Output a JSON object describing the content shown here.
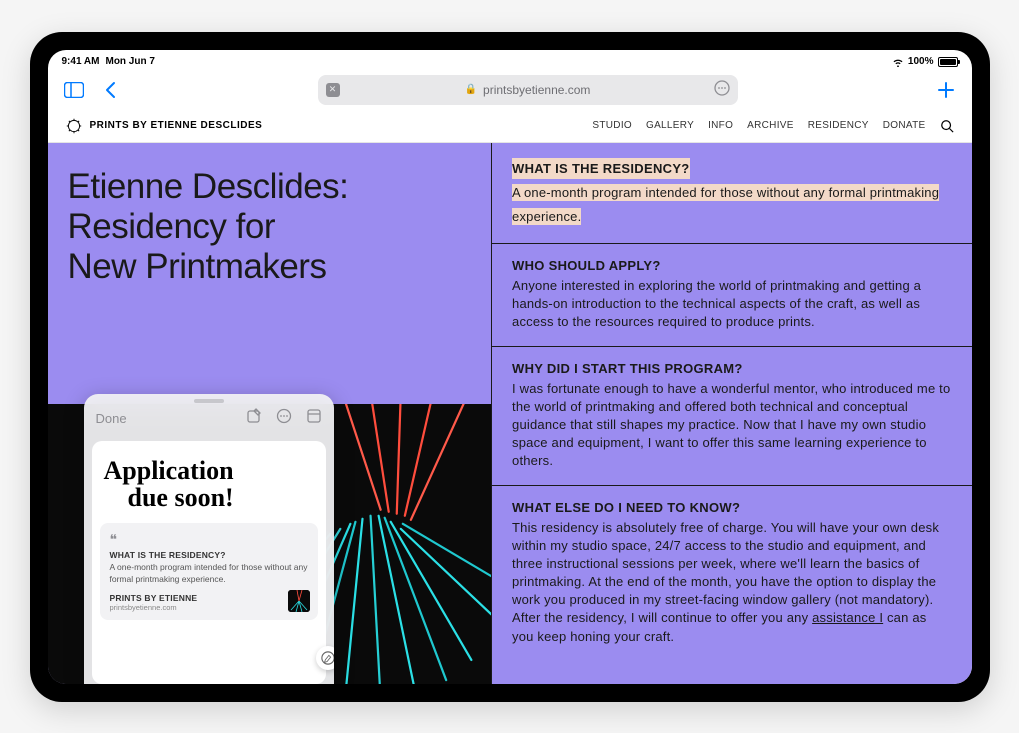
{
  "status": {
    "time": "9:41 AM",
    "date": "Mon Jun 7",
    "battery_pct": "100%"
  },
  "browser": {
    "url": "printsbyetienne.com"
  },
  "site": {
    "title": "PRINTS BY ETIENNE DESCLIDES",
    "nav": [
      "STUDIO",
      "GALLERY",
      "INFO",
      "ARCHIVE",
      "RESIDENCY",
      "DONATE"
    ]
  },
  "hero": {
    "line1": "Etienne Desclides:",
    "line2": "Residency for",
    "line3": "New Printmakers"
  },
  "faqs": [
    {
      "q": "WHAT IS THE RESIDENCY?",
      "a": "A one-month program intended for those without any formal printmaking experience.",
      "highlighted": true
    },
    {
      "q": "WHO SHOULD APPLY?",
      "a": "Anyone interested in exploring the world of printmaking and getting a hands-on introduction to the technical aspects of the craft, as well as access to the resources required to produce prints."
    },
    {
      "q": "WHY DID I START THIS PROGRAM?",
      "a": "I was fortunate enough to have a wonderful mentor, who introduced me to the world of printmaking and offered both technical and conceptual guidance that still shapes my practice. Now that I have my own studio space and equipment, I want to offer this same learning experience to others."
    },
    {
      "q": "WHAT ELSE DO I NEED TO KNOW?",
      "a_pre": "This residency is absolutely free of charge. You will have your own desk within my studio space, 24/7 access to the studio and equipment, and three instructional sessions per week, where we'll learn the basics of printmaking. At the end of the month, you have the option to display the work you produced in my street-facing window gallery (not mandatory). After the residency, I will continue to offer you any ",
      "a_underlined": "assistance I",
      "a_post": " can as you keep honing your craft."
    }
  ],
  "note": {
    "done": "Done",
    "handwriting_l1": "Application",
    "handwriting_l2": "due soon!",
    "quote": {
      "title": "WHAT IS THE RESIDENCY?",
      "body": "A one-month program intended for those without any formal printmaking experience.",
      "source": "PRINTS BY ETIENNE",
      "url": "printsbyetienne.com"
    }
  }
}
